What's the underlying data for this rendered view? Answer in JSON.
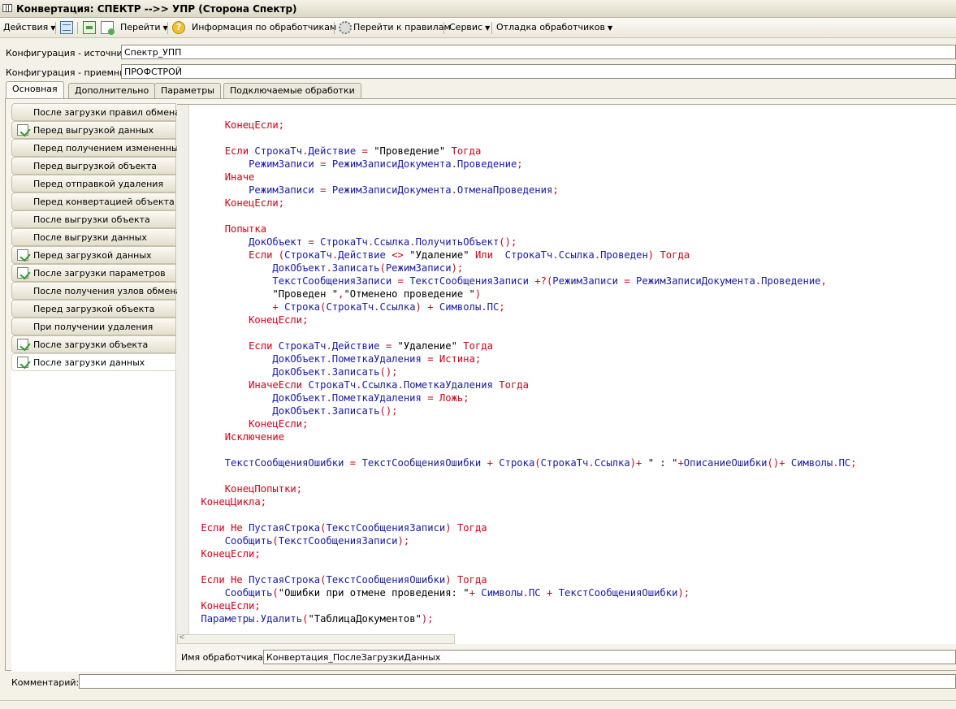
{
  "window": {
    "title": "Конвертация: СПЕКТР -->> УПР (Сторона Спектр)"
  },
  "toolbar": {
    "actions": "Действия",
    "goto": "Перейти",
    "handlers_info": "Информация по обработчикам ...",
    "goto_rules": "Перейти к правилам",
    "service": "Сервис",
    "debug_handlers": "Отладка обработчиков"
  },
  "config": {
    "source_label": "Конфигурация - источник:",
    "source_value": "Спектр_УПП",
    "target_label": "Конфигурация - приемник:",
    "target_value": "ПРОФСТРОЙ"
  },
  "tabs": [
    "Основная",
    "Дополнительно",
    "Параметры",
    "Подключаемые обработки"
  ],
  "events": [
    {
      "label": "После загрузки правил обмена",
      "checked": false
    },
    {
      "label": "Перед выгрузкой данных",
      "checked": true
    },
    {
      "label": "Перед получением измененных",
      "checked": false
    },
    {
      "label": "Перед выгрузкой объекта",
      "checked": false
    },
    {
      "label": "Перед отправкой удаления",
      "checked": false
    },
    {
      "label": "Перед конвертацией объекта",
      "checked": false
    },
    {
      "label": "После выгрузки объекта",
      "checked": false
    },
    {
      "label": "После выгрузки данных",
      "checked": false
    },
    {
      "label": "Перед загрузкой данных",
      "checked": true
    },
    {
      "label": "После загрузки параметров",
      "checked": true
    },
    {
      "label": "После получения узлов обмена",
      "checked": false
    },
    {
      "label": "Перед загрузкой объекта",
      "checked": false
    },
    {
      "label": "При получении удаления",
      "checked": false
    },
    {
      "label": "После загрузки объекта",
      "checked": true
    },
    {
      "label": "После загрузки данных",
      "checked": true,
      "selected": true
    }
  ],
  "code_lines": [
    "        КонецЕсли;",
    "",
    "        Если СтрокаТч.Действие = \"Проведение\" Тогда",
    "            РежимЗаписи = РежимЗаписиДокумента.Проведение;",
    "        Иначе",
    "            РежимЗаписи = РежимЗаписиДокумента.ОтменаПроведения;",
    "        КонецЕсли;",
    "",
    "        Попытка",
    "            ДокОбъект = СтрокаТч.Ссылка.ПолучитьОбъект();",
    "            Если (СтрокаТч.Действие <> \"Удаление\" Или  СтрокаТч.Ссылка.Проведен) Тогда",
    "                ДокОбъект.Записать(РежимЗаписи);",
    "                ТекстСообщенияЗаписи = ТекстСообщенияЗаписи +?(РежимЗаписи = РежимЗаписиДокумента.Проведение,",
    "                \"Проведен \",\"Отменено проведение \")",
    "                + Строка(СтрокаТч.Ссылка) + Символы.ПС;",
    "            КонецЕсли;",
    "",
    "            Если СтрокаТч.Действие = \"Удаление\" Тогда",
    "                ДокОбъект.ПометкаУдаления = Истина;",
    "                ДокОбъект.Записать();",
    "            ИначеЕсли СтрокаТч.Ссылка.ПометкаУдаления Тогда",
    "                ДокОбъект.ПометкаУдаления = Ложь;",
    "                ДокОбъект.Записать();",
    "            КонецЕсли;",
    "        Исключение",
    "",
    "        ТекстСообщенияОшибки = ТекстСообщенияОшибки + Строка(СтрокаТч.Ссылка)+ \" : \"+ОписаниеОшибки()+ Символы.ПС;",
    "",
    "        КонецПопытки;",
    "    КонецЦикла;",
    "",
    "    Если Не ПустаяСтрока(ТекстСообщенияЗаписи) Тогда",
    "        Сообщить(ТекстСообщенияЗаписи);",
    "    КонецЕсли;",
    "",
    "    Если Не ПустаяСтрока(ТекстСообщенияОшибки) Тогда",
    "        Сообщить(\"Ошибки при отмене проведения: \"+ Символы.ПС + ТекстСообщенияОшибки);",
    "    КонецЕсли;",
    "    Параметры.Удалить(\"ТаблицаДокументов\");"
  ],
  "handler": {
    "label": "Имя обработчика:",
    "value": "Конвертация_ПослеЗагрузкиДанных"
  },
  "comment": {
    "label": "Комментарий:",
    "value": ""
  }
}
